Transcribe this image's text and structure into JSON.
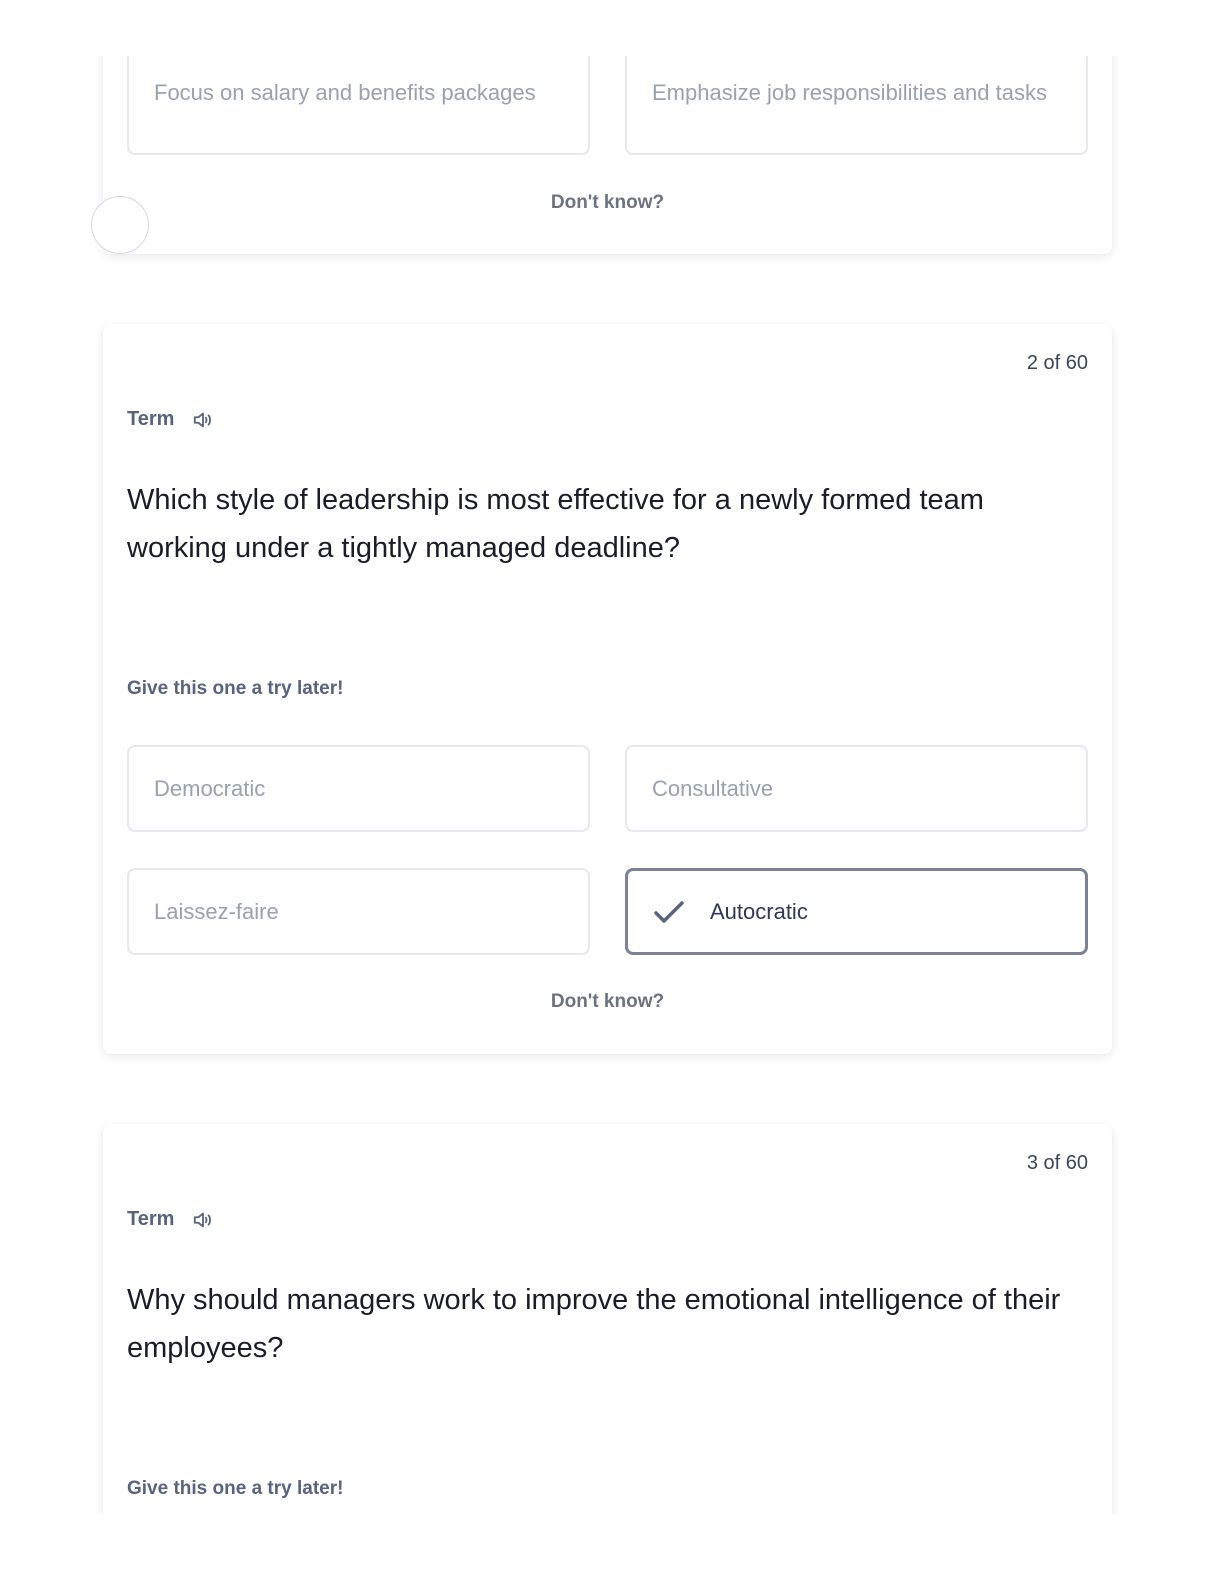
{
  "previous_card": {
    "options": [
      "Focus on salary and benefits packages",
      "Emphasize job responsibilities and tasks"
    ],
    "dont_know": "Don't know?"
  },
  "cards": [
    {
      "counter": "2 of 60",
      "term_label": "Term",
      "question": "Which style of leadership is most effective for a newly formed team working under a tightly managed deadline?",
      "try_later": "Give this one a try later!",
      "options": [
        "Democratic",
        "Consultative",
        "Laissez-faire",
        "Autocratic"
      ],
      "selected_option": "Autocratic",
      "dont_know": "Don't know?"
    },
    {
      "counter": "3 of 60",
      "term_label": "Term",
      "question": "Why should managers work to improve the emotional intelligence of their employees?",
      "try_later": "Give this one a try later!"
    }
  ],
  "icons": {
    "speaker": "speaker-icon",
    "check": "check-icon"
  },
  "colors": {
    "label": "#586380",
    "option_border": "#e6e8ee",
    "selected_border": "#7c8199",
    "question_text": "#1a1d28"
  }
}
